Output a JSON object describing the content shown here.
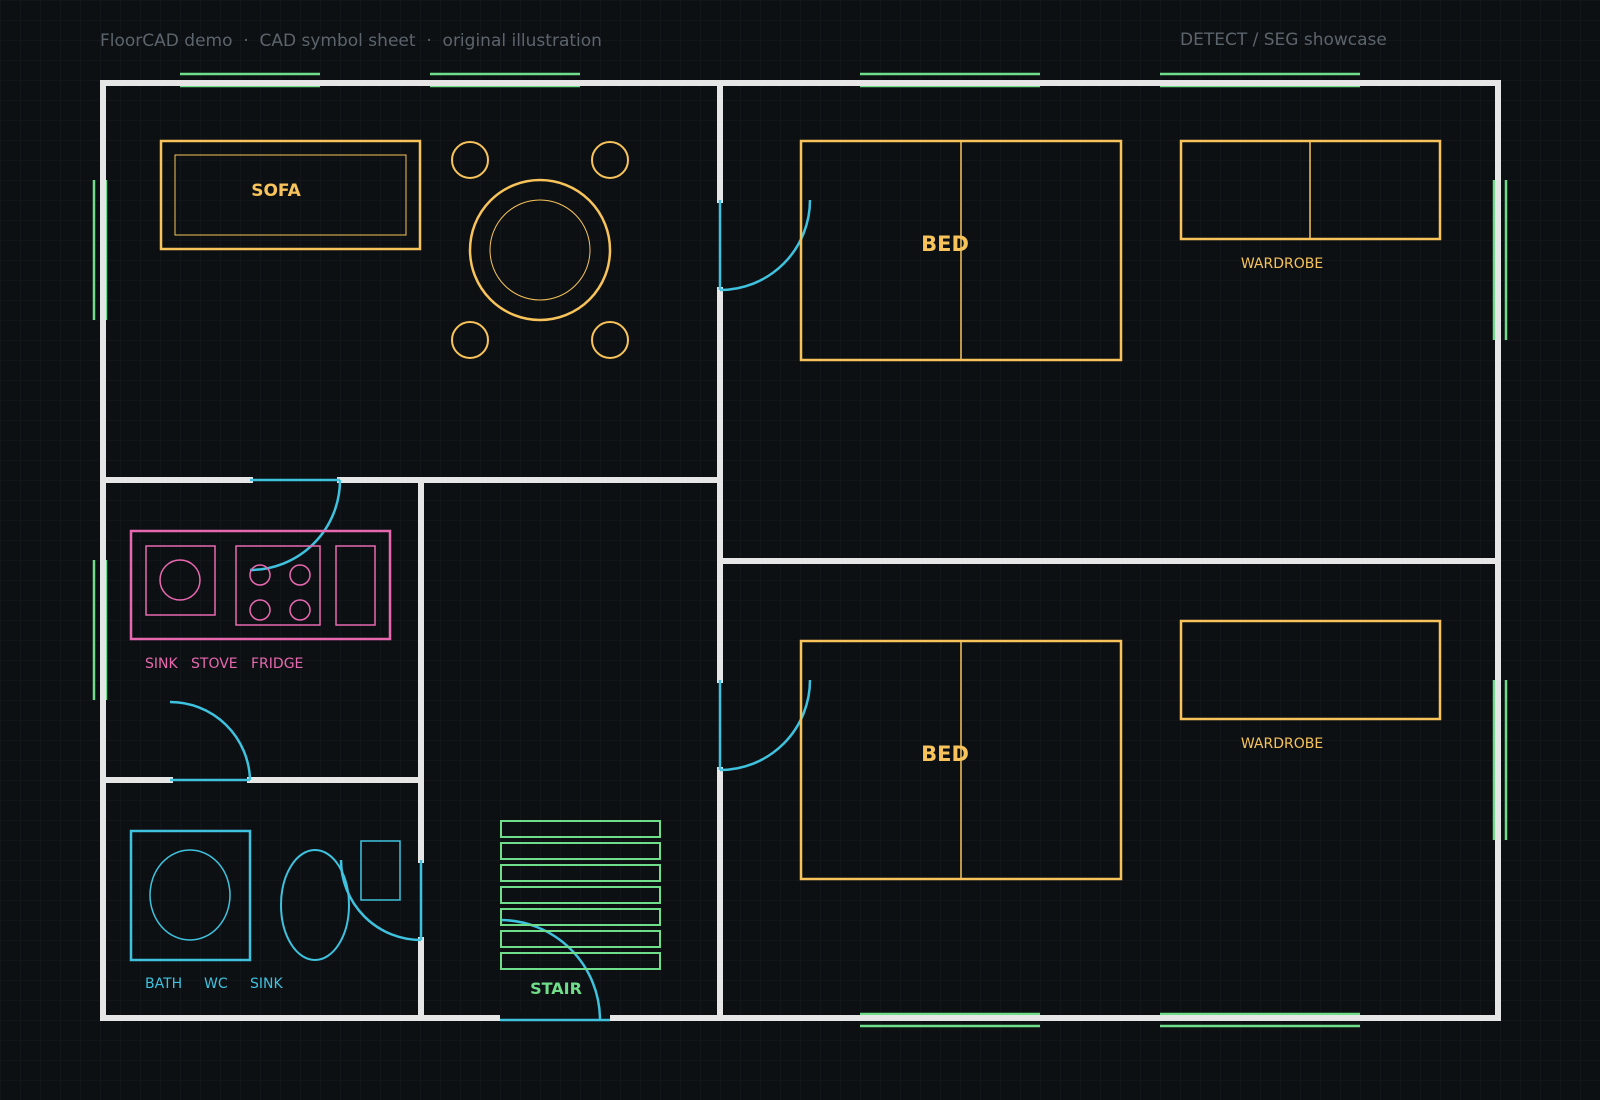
{
  "header": {
    "left": "FloorCAD demo  ·  CAD symbol sheet  ·  original illustration",
    "right": "DETECT / SEG showcase"
  },
  "labels": {
    "sofa": "SOFA",
    "bed_top": "BED",
    "bed_bottom": "BED",
    "wardrobe_top": "WARDROBE",
    "wardrobe_bottom": "WARDROBE",
    "sink_kitchen": "SINK",
    "stove": "STOVE",
    "fridge": "FRIDGE",
    "bath": "BATH",
    "wc": "WC",
    "sink_bath": "SINK",
    "stair": "STAIR"
  },
  "colors": {
    "background": "#0d1013",
    "grid": "#171c21",
    "wall": "#e6e6e6",
    "furniture": "#f7c35a",
    "kitchen": "#e868b0",
    "bathroom": "#3fc2de",
    "door": "#3fc2de",
    "window": "#6fdd8a",
    "stair": "#6fdd8a",
    "header_text": "#5c646c"
  }
}
